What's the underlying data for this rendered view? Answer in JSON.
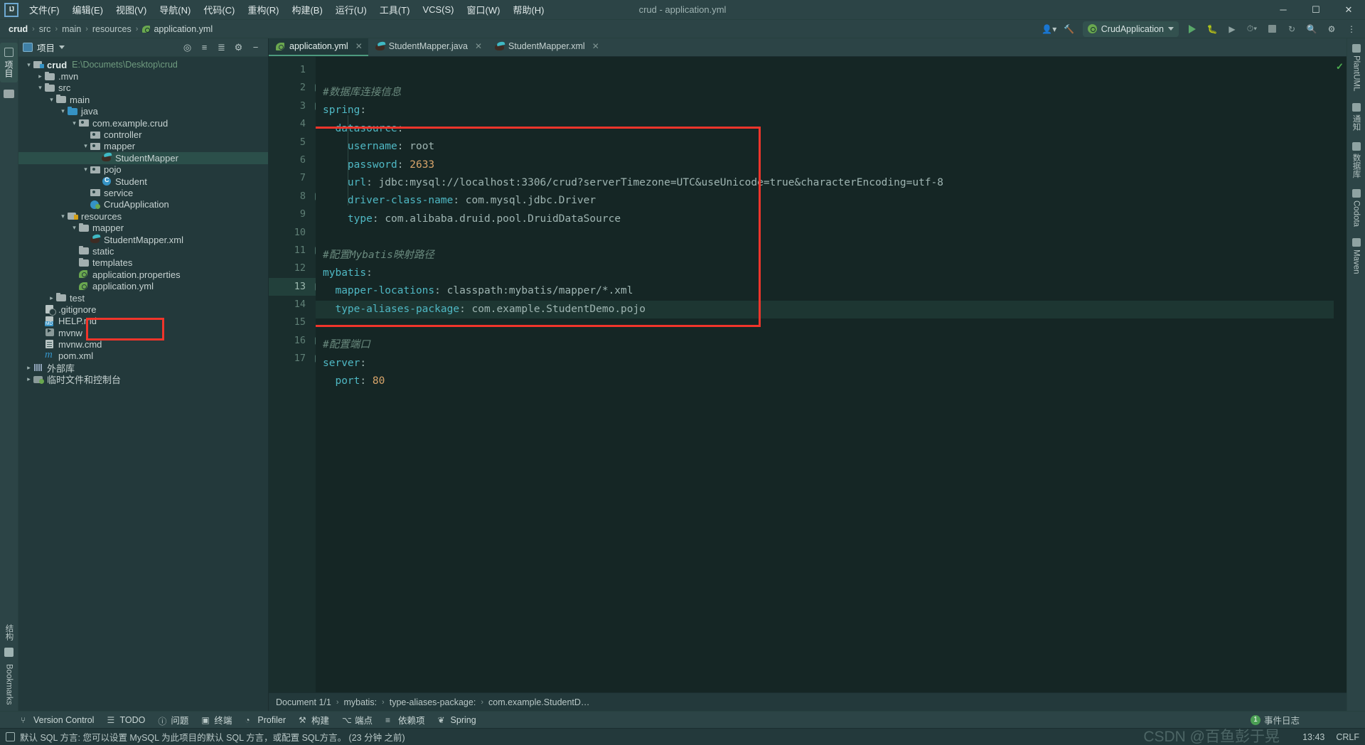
{
  "window": {
    "title": "crud - application.yml",
    "logo_text": "IJ",
    "controls": {
      "minimize": "─",
      "maximize": "☐",
      "close": "✕"
    }
  },
  "menu": [
    {
      "label": "文件(F)",
      "name": "menu-file"
    },
    {
      "label": "编辑(E)",
      "name": "menu-edit"
    },
    {
      "label": "视图(V)",
      "name": "menu-view"
    },
    {
      "label": "导航(N)",
      "name": "menu-navigate"
    },
    {
      "label": "代码(C)",
      "name": "menu-code"
    },
    {
      "label": "重构(R)",
      "name": "menu-refactor"
    },
    {
      "label": "构建(B)",
      "name": "menu-build"
    },
    {
      "label": "运行(U)",
      "name": "menu-run"
    },
    {
      "label": "工具(T)",
      "name": "menu-tools"
    },
    {
      "label": "VCS(S)",
      "name": "menu-vcs"
    },
    {
      "label": "窗口(W)",
      "name": "menu-window"
    },
    {
      "label": "帮助(H)",
      "name": "menu-help"
    }
  ],
  "breadcrumb": {
    "root": "crud",
    "items": [
      "src",
      "main",
      "resources"
    ],
    "file": "application.yml"
  },
  "run_toolbar": {
    "config_name": "CrudApplication",
    "run_title": "Run",
    "debug_title": "Debug",
    "stop_title": "Stop",
    "profile_title": "Profile",
    "search_title": "Search",
    "settings_title": "Settings"
  },
  "project_panel": {
    "title": "项目",
    "vertical_label": "项目",
    "tree": [
      {
        "depth": 0,
        "arrow": "down",
        "icon": "module",
        "label": "crud",
        "bold": true,
        "sub": "E:\\Documets\\Desktop\\crud",
        "selected": false
      },
      {
        "depth": 1,
        "arrow": "right",
        "icon": "folder",
        "label": ".mvn",
        "selected": false
      },
      {
        "depth": 1,
        "arrow": "down",
        "icon": "folder",
        "label": "src",
        "selected": false
      },
      {
        "depth": 2,
        "arrow": "down",
        "icon": "folder",
        "label": "main",
        "selected": false
      },
      {
        "depth": 3,
        "arrow": "down",
        "icon": "folder-blue",
        "label": "java",
        "selected": false
      },
      {
        "depth": 4,
        "arrow": "down",
        "icon": "package",
        "label": "com.example.crud",
        "selected": false
      },
      {
        "depth": 5,
        "arrow": "none",
        "icon": "package",
        "label": "controller",
        "selected": false
      },
      {
        "depth": 5,
        "arrow": "down",
        "icon": "package",
        "label": "mapper",
        "selected": false
      },
      {
        "depth": 6,
        "arrow": "none",
        "icon": "mybatis",
        "label": "StudentMapper",
        "selected": true
      },
      {
        "depth": 5,
        "arrow": "down",
        "icon": "package",
        "label": "pojo",
        "selected": false
      },
      {
        "depth": 6,
        "arrow": "none",
        "icon": "class",
        "label": "Student",
        "selected": false
      },
      {
        "depth": 5,
        "arrow": "none",
        "icon": "package",
        "label": "service",
        "selected": false
      },
      {
        "depth": 5,
        "arrow": "none",
        "icon": "springboot",
        "label": "CrudApplication",
        "selected": false
      },
      {
        "depth": 3,
        "arrow": "down",
        "icon": "resources",
        "label": "resources",
        "selected": false
      },
      {
        "depth": 4,
        "arrow": "down",
        "icon": "folder",
        "label": "mapper",
        "selected": false
      },
      {
        "depth": 5,
        "arrow": "none",
        "icon": "mybatis",
        "label": "StudentMapper.xml",
        "selected": false
      },
      {
        "depth": 4,
        "arrow": "none",
        "icon": "folder",
        "label": "static",
        "selected": false
      },
      {
        "depth": 4,
        "arrow": "none",
        "icon": "folder",
        "label": "templates",
        "selected": false
      },
      {
        "depth": 4,
        "arrow": "none",
        "icon": "spring",
        "label": "application.properties",
        "selected": false
      },
      {
        "depth": 4,
        "arrow": "none",
        "icon": "spring",
        "label": "application.yml",
        "selected": false
      },
      {
        "depth": 2,
        "arrow": "right",
        "icon": "folder",
        "label": "test",
        "selected": false
      },
      {
        "depth": 1,
        "arrow": "none",
        "icon": "git",
        "label": ".gitignore",
        "selected": false
      },
      {
        "depth": 1,
        "arrow": "none",
        "icon": "md",
        "label": "HELP.md",
        "selected": false
      },
      {
        "depth": 1,
        "arrow": "none",
        "icon": "sh",
        "label": "mvnw",
        "selected": false
      },
      {
        "depth": 1,
        "arrow": "none",
        "icon": "cmd",
        "label": "mvnw.cmd",
        "selected": false
      },
      {
        "depth": 1,
        "arrow": "none",
        "icon": "maven",
        "label": "pom.xml",
        "selected": false
      },
      {
        "depth": 0,
        "arrow": "right",
        "icon": "library",
        "label": "外部库",
        "selected": false
      },
      {
        "depth": 0,
        "arrow": "right",
        "icon": "console",
        "label": "临时文件和控制台",
        "selected": false
      }
    ]
  },
  "editor": {
    "tabs": [
      {
        "label": "application.yml",
        "icon": "spring",
        "active": true
      },
      {
        "label": "StudentMapper.java",
        "icon": "mybatis",
        "active": false
      },
      {
        "label": "StudentMapper.xml",
        "icon": "mybatis",
        "active": false
      }
    ],
    "current_line": 13,
    "lines": [
      {
        "n": 1,
        "fold": "none",
        "segments": [
          {
            "t": "#数据库连接信息",
            "c": "cm"
          }
        ],
        "indent": 2
      },
      {
        "n": 2,
        "fold": "minus-top",
        "segments": [
          {
            "t": "spring",
            "c": "key"
          },
          {
            "t": ":",
            "c": "punct"
          }
        ],
        "indent": 0
      },
      {
        "n": 3,
        "fold": "minus-top",
        "segments": [
          {
            "t": "  datasource",
            "c": "key"
          },
          {
            "t": ":",
            "c": "punct"
          }
        ],
        "indent": 2
      },
      {
        "n": 4,
        "fold": "none",
        "segments": [
          {
            "t": "    username",
            "c": "key"
          },
          {
            "t": ": ",
            "c": "punct"
          },
          {
            "t": "root",
            "c": "val"
          }
        ],
        "indent": 4
      },
      {
        "n": 5,
        "fold": "none",
        "segments": [
          {
            "t": "    password",
            "c": "key"
          },
          {
            "t": ": ",
            "c": "punct"
          },
          {
            "t": "2633",
            "c": "num"
          }
        ],
        "indent": 4
      },
      {
        "n": 6,
        "fold": "none",
        "segments": [
          {
            "t": "    url",
            "c": "key"
          },
          {
            "t": ": ",
            "c": "punct"
          },
          {
            "t": "jdbc:mysql://localhost:3306/crud?serverTimezone=UTC&useUnicode=true&characterEncoding=utf-8",
            "c": "val"
          }
        ],
        "indent": 4
      },
      {
        "n": 7,
        "fold": "none",
        "segments": [
          {
            "t": "    driver-class-name",
            "c": "key"
          },
          {
            "t": ": ",
            "c": "punct"
          },
          {
            "t": "com.mysql.jdbc.Driver",
            "c": "val"
          }
        ],
        "indent": 4
      },
      {
        "n": 8,
        "fold": "minus-bottom",
        "segments": [
          {
            "t": "    type",
            "c": "key"
          },
          {
            "t": ": ",
            "c": "punct"
          },
          {
            "t": "com.alibaba.druid.pool.DruidDataSource",
            "c": "val"
          }
        ],
        "indent": 4
      },
      {
        "n": 9,
        "fold": "none",
        "segments": [],
        "indent": 0
      },
      {
        "n": 10,
        "fold": "none",
        "segments": [
          {
            "t": "#配置Mybatis映射路径",
            "c": "cm"
          }
        ],
        "indent": 0
      },
      {
        "n": 11,
        "fold": "minus-top",
        "segments": [
          {
            "t": "mybatis",
            "c": "key"
          },
          {
            "t": ":",
            "c": "punct"
          }
        ],
        "indent": 0
      },
      {
        "n": 12,
        "fold": "none",
        "segments": [
          {
            "t": "  mapper-locations",
            "c": "key"
          },
          {
            "t": ": ",
            "c": "punct"
          },
          {
            "t": "classpath:mybatis/mapper/*.xml",
            "c": "val"
          }
        ],
        "indent": 2
      },
      {
        "n": 13,
        "fold": "minus-bottom",
        "segments": [
          {
            "t": "  type-aliases-package",
            "c": "key"
          },
          {
            "t": ": ",
            "c": "punct"
          },
          {
            "t": "com.example.StudentDemo.pojo",
            "c": "val"
          }
        ],
        "indent": 2
      },
      {
        "n": 14,
        "fold": "none",
        "segments": [],
        "indent": 0
      },
      {
        "n": 15,
        "fold": "none",
        "segments": [
          {
            "t": "#配置端口",
            "c": "cm"
          }
        ],
        "indent": 0
      },
      {
        "n": 16,
        "fold": "minus-top",
        "segments": [
          {
            "t": "server",
            "c": "key"
          },
          {
            "t": ":",
            "c": "punct"
          }
        ],
        "indent": 0
      },
      {
        "n": 17,
        "fold": "minus-bottom",
        "segments": [
          {
            "t": "  port",
            "c": "key"
          },
          {
            "t": ": ",
            "c": "punct"
          },
          {
            "t": "80",
            "c": "num"
          }
        ],
        "indent": 2
      }
    ],
    "inspection_status": "✓"
  },
  "editor_breadcrumb": {
    "document": "Document 1/1",
    "path": [
      "mybatis:",
      "type-aliases-package:",
      "com.example.StudentD…"
    ]
  },
  "right_strip": [
    {
      "label": "PlantUML",
      "name": "plantuml"
    },
    {
      "label": "通知",
      "name": "notifications"
    },
    {
      "label": "数据库",
      "name": "database"
    },
    {
      "label": "Codota",
      "name": "codota"
    },
    {
      "label": "Maven",
      "name": "maven"
    }
  ],
  "left_strip_bottom": [
    {
      "label": "结构",
      "name": "structure"
    },
    {
      "label": "Bookmarks",
      "name": "bookmarks"
    }
  ],
  "bottom_bar": [
    {
      "label": "Version Control",
      "icon": "branch-icon"
    },
    {
      "label": "TODO",
      "icon": "list-icon"
    },
    {
      "label": "问题",
      "icon": "warning-icon"
    },
    {
      "label": "终端",
      "icon": "terminal-icon"
    },
    {
      "label": "Profiler",
      "icon": "gauge-icon"
    },
    {
      "label": "构建",
      "icon": "hammer-icon"
    },
    {
      "label": "端点",
      "icon": "endpoints-icon"
    },
    {
      "label": "依赖项",
      "icon": "layers-icon"
    },
    {
      "label": "Spring",
      "icon": "leaf-icon"
    }
  ],
  "status_bar": {
    "notification": "默认 SQL 方言: 您可以设置 MySQL 为此项目的默认 SQL 方言，或配置 SQL方言。 (23 分钟 之前)",
    "event_log": "事件日志",
    "event_count": "1",
    "time": "13:43",
    "line_ending": "CRLF",
    "watermark": "CSDN @百鱼彭于晃"
  },
  "colors": {
    "accent_green": "#6aa84f",
    "annotation_red": "#f0352b",
    "selection": "#2b4f4a",
    "key": "#4fb8c4",
    "comment": "#6a8a7e",
    "number": "#d9a56b"
  }
}
